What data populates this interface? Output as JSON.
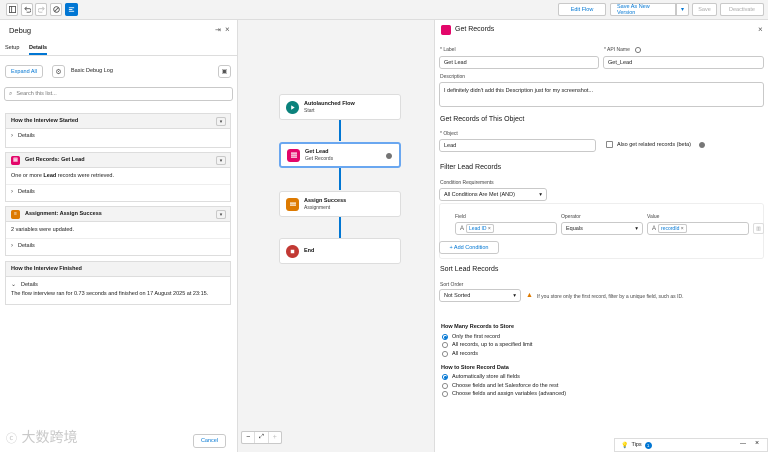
{
  "toolbar": {
    "edit_flow": "Edit Flow",
    "save_new_version": "Save As New Version",
    "save": "Save",
    "deactivate": "Deactivate"
  },
  "debug": {
    "title": "Debug",
    "tabs": [
      "Setup",
      "Details"
    ],
    "expand_all": "Expand All",
    "log_label": "Basic Debug Log",
    "search_placeholder": "Search this list...",
    "sections": [
      {
        "title": "How the Interview Started",
        "details": "Details"
      },
      {
        "title": "Get Records: Get Lead",
        "text_pre": "One or more ",
        "text_bold": "Lead",
        "text_post": " records were retrieved.",
        "details": "Details"
      },
      {
        "title": "Assignment: Assign Success",
        "text": "2 variables were updated.",
        "details": "Details"
      },
      {
        "title": "How the Interview Finished",
        "details": "Details",
        "text": "The flow interview ran for 0.73 seconds and finished on 17 August 2025 at 23:15."
      }
    ],
    "cancel": "Cancel"
  },
  "canvas": {
    "nodes": [
      {
        "title": "Autolaunched Flow",
        "subtitle": "Start"
      },
      {
        "title": "Get Lead",
        "subtitle": "Get Records"
      },
      {
        "title": "Assign Success",
        "subtitle": "Assignment"
      },
      {
        "title": "End",
        "subtitle": ""
      }
    ]
  },
  "panel": {
    "title": "Get Records",
    "label_lbl": "* Label",
    "label_val": "Get Lead",
    "api_lbl": "* API Name",
    "api_val": "Get_Lead",
    "desc_lbl": "Description",
    "desc_val": "I definitely didn't add this Description just for my screenshot...",
    "get_records_title": "Get Records of This Object",
    "object_lbl": "* Object",
    "object_val": "Lead",
    "related_lbl": "Also get related records (beta)",
    "filter_title": "Filter Lead Records",
    "cond_req_lbl": "Condition Requirements",
    "cond_req_val": "All Conditions Are Met (AND)",
    "field_lbl": "Field",
    "operator_lbl": "Operator",
    "value_lbl": "Value",
    "field_val": "Lead ID",
    "operator_val": "Equals",
    "value_val": "recordId",
    "add_condition": "+ Add Condition",
    "sort_title": "Sort Lead Records",
    "sort_order_lbl": "Sort Order",
    "sort_order_val": "Not Sorted",
    "sort_warning": "If you store only the first record, filter by a unique field, such as ID.",
    "how_many_title": "How Many Records to Store",
    "how_many": [
      "Only the first record",
      "All records, up to a specified limit",
      "All records"
    ],
    "how_store_title": "How to Store Record Data",
    "how_store": [
      "Automatically store all fields",
      "Choose fields and let Salesforce do the rest",
      "Choose fields and assign variables (advanced)"
    ],
    "tips": "Tips",
    "tips_count": "1"
  },
  "watermark": "大数跨境"
}
